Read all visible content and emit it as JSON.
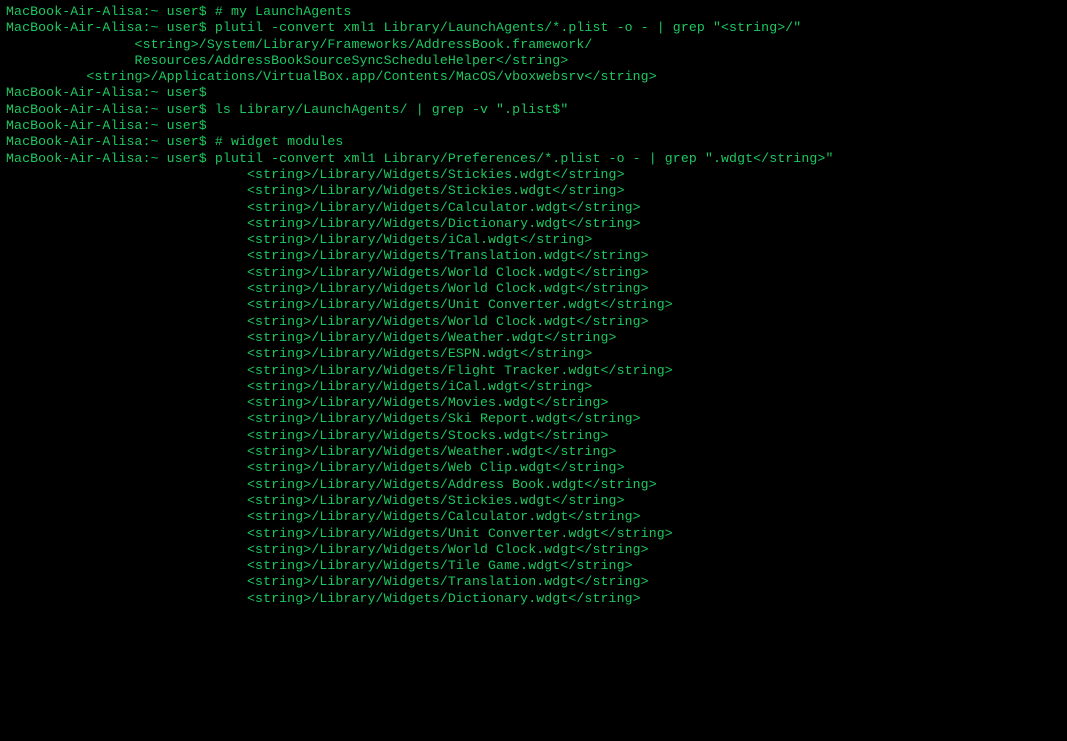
{
  "prompt": "MacBook-Air-Alisa:~ user$ ",
  "lines": [
    {
      "p": true,
      "indent": 0,
      "t": "# my LaunchAgents"
    },
    {
      "p": true,
      "indent": 0,
      "t": "plutil -convert xml1 Library/LaunchAgents/*.plist -o - | grep \"<string>/\""
    },
    {
      "p": false,
      "indent": 16,
      "t": "<string>/System/Library/Frameworks/AddressBook.framework/"
    },
    {
      "p": false,
      "indent": 16,
      "t": "Resources/AddressBookSourceSyncScheduleHelper</string>"
    },
    {
      "p": false,
      "indent": 10,
      "t": "<string>/Applications/VirtualBox.app/Contents/MacOS/vboxwebsrv</string>"
    },
    {
      "p": true,
      "indent": 0,
      "t": ""
    },
    {
      "p": true,
      "indent": 0,
      "t": "ls Library/LaunchAgents/ | grep -v \".plist$\""
    },
    {
      "p": true,
      "indent": 0,
      "t": ""
    },
    {
      "p": true,
      "indent": 0,
      "t": "# widget modules"
    },
    {
      "p": true,
      "indent": 0,
      "t": "plutil -convert xml1 Library/Preferences/*.plist -o - | grep \".wdgt</string>\""
    },
    {
      "p": false,
      "indent": 30,
      "t": "<string>/Library/Widgets/Stickies.wdgt</string>"
    },
    {
      "p": false,
      "indent": 30,
      "t": "<string>/Library/Widgets/Stickies.wdgt</string>"
    },
    {
      "p": false,
      "indent": 30,
      "t": "<string>/Library/Widgets/Calculator.wdgt</string>"
    },
    {
      "p": false,
      "indent": 30,
      "t": "<string>/Library/Widgets/Dictionary.wdgt</string>"
    },
    {
      "p": false,
      "indent": 30,
      "t": "<string>/Library/Widgets/iCal.wdgt</string>"
    },
    {
      "p": false,
      "indent": 30,
      "t": "<string>/Library/Widgets/Translation.wdgt</string>"
    },
    {
      "p": false,
      "indent": 30,
      "t": "<string>/Library/Widgets/World Clock.wdgt</string>"
    },
    {
      "p": false,
      "indent": 30,
      "t": "<string>/Library/Widgets/World Clock.wdgt</string>"
    },
    {
      "p": false,
      "indent": 30,
      "t": "<string>/Library/Widgets/Unit Converter.wdgt</string>"
    },
    {
      "p": false,
      "indent": 30,
      "t": "<string>/Library/Widgets/World Clock.wdgt</string>"
    },
    {
      "p": false,
      "indent": 30,
      "t": "<string>/Library/Widgets/Weather.wdgt</string>"
    },
    {
      "p": false,
      "indent": 30,
      "t": "<string>/Library/Widgets/ESPN.wdgt</string>"
    },
    {
      "p": false,
      "indent": 30,
      "t": "<string>/Library/Widgets/Flight Tracker.wdgt</string>"
    },
    {
      "p": false,
      "indent": 30,
      "t": "<string>/Library/Widgets/iCal.wdgt</string>"
    },
    {
      "p": false,
      "indent": 30,
      "t": "<string>/Library/Widgets/Movies.wdgt</string>"
    },
    {
      "p": false,
      "indent": 30,
      "t": "<string>/Library/Widgets/Ski Report.wdgt</string>"
    },
    {
      "p": false,
      "indent": 30,
      "t": "<string>/Library/Widgets/Stocks.wdgt</string>"
    },
    {
      "p": false,
      "indent": 30,
      "t": "<string>/Library/Widgets/Weather.wdgt</string>"
    },
    {
      "p": false,
      "indent": 30,
      "t": "<string>/Library/Widgets/Web Clip.wdgt</string>"
    },
    {
      "p": false,
      "indent": 30,
      "t": "<string>/Library/Widgets/Address Book.wdgt</string>"
    },
    {
      "p": false,
      "indent": 30,
      "t": "<string>/Library/Widgets/Stickies.wdgt</string>"
    },
    {
      "p": false,
      "indent": 30,
      "t": "<string>/Library/Widgets/Calculator.wdgt</string>"
    },
    {
      "p": false,
      "indent": 30,
      "t": "<string>/Library/Widgets/Unit Converter.wdgt</string>"
    },
    {
      "p": false,
      "indent": 30,
      "t": "<string>/Library/Widgets/World Clock.wdgt</string>"
    },
    {
      "p": false,
      "indent": 30,
      "t": "<string>/Library/Widgets/Tile Game.wdgt</string>"
    },
    {
      "p": false,
      "indent": 30,
      "t": "<string>/Library/Widgets/Translation.wdgt</string>"
    },
    {
      "p": false,
      "indent": 30,
      "t": "<string>/Library/Widgets/Dictionary.wdgt</string>"
    }
  ]
}
